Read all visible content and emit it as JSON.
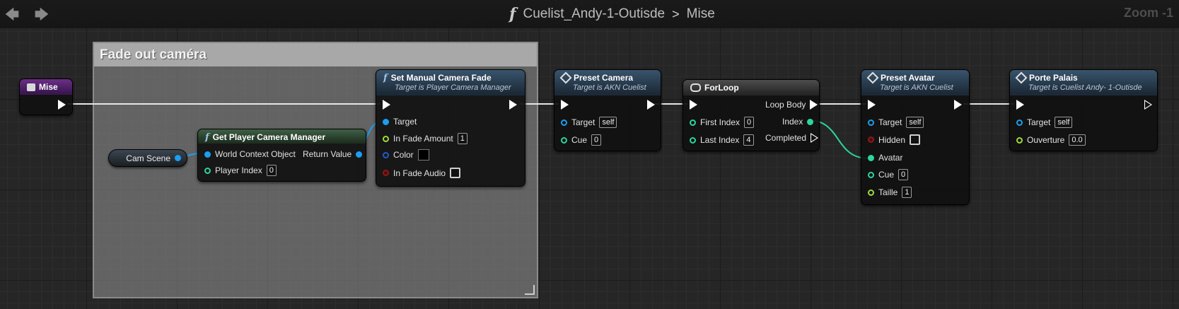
{
  "toolbar": {
    "back_icon": "arrow-left-icon",
    "forward_icon": "arrow-right-icon",
    "function_glyph": "f",
    "breadcrumb": [
      "Cuelist_Andy-1-Outisde",
      "Mise"
    ],
    "separator": ">",
    "zoom_label": "Zoom -1"
  },
  "comment": {
    "title": "Fade out caméra"
  },
  "wire_colors": {
    "exec": "#e6e6e6",
    "object": "#1d9ef0",
    "int": "#2bd6a0"
  },
  "nodes": {
    "mise": {
      "title": "Mise",
      "color": "#6b2e86"
    },
    "cam_scene": {
      "label": "Cam Scene"
    },
    "get_pcm": {
      "title": "Get Player Camera Manager",
      "pins": {
        "world_context": "World Context Object",
        "return_value": "Return Value",
        "player_index": "Player Index",
        "player_index_value": "0"
      }
    },
    "set_fade": {
      "title": "Set Manual Camera Fade",
      "subtitle": "Target is Player Camera Manager",
      "pins": {
        "target": "Target",
        "fade_amount": "In Fade Amount",
        "fade_amount_value": "1",
        "color": "Color",
        "color_value": "#000000",
        "fade_audio": "In Fade Audio"
      }
    },
    "preset_camera": {
      "title": "Preset Camera",
      "subtitle": "Target is AKN Cuelist",
      "pins": {
        "target": "Target",
        "target_value": "self",
        "cue": "Cue",
        "cue_value": "0"
      }
    },
    "forloop": {
      "title": "ForLoop",
      "pins": {
        "loop_body": "Loop Body",
        "first_index": "First Index",
        "first_index_value": "0",
        "index": "Index",
        "last_index": "Last Index",
        "last_index_value": "4",
        "completed": "Completed"
      }
    },
    "preset_avatar": {
      "title": "Preset Avatar",
      "subtitle": "Target is AKN Cuelist",
      "pins": {
        "target": "Target",
        "target_value": "self",
        "hidden": "Hidden",
        "avatar": "Avatar",
        "cue": "Cue",
        "cue_value": "0",
        "taille": "Taille",
        "taille_value": "1"
      }
    },
    "porte_palais": {
      "title": "Porte Palais",
      "subtitle": "Target is Cuelist Andy- 1-Outisde",
      "pins": {
        "target": "Target",
        "target_value": "self",
        "ouverture": "Ouverture",
        "ouverture_value": "0.0"
      }
    }
  }
}
